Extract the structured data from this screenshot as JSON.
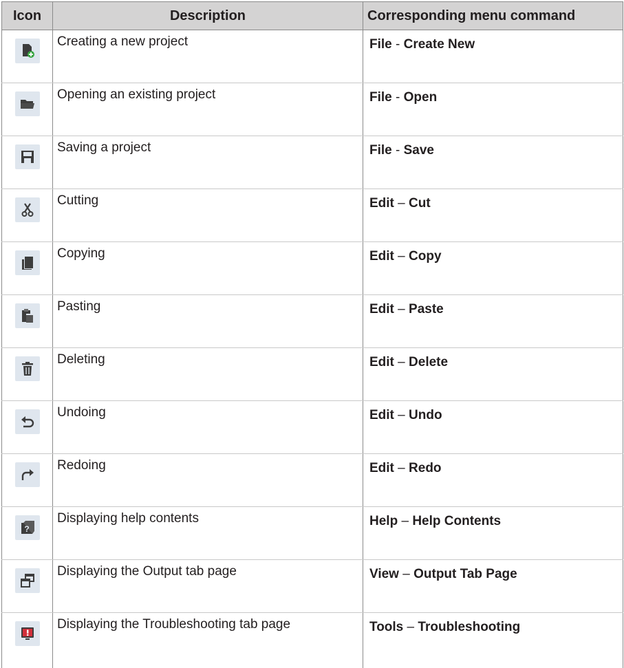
{
  "header": {
    "icon": "Icon",
    "description": "Description",
    "command": "Corresponding menu command"
  },
  "rows": [
    {
      "icon": "create-new-icon",
      "description": "Creating a new project",
      "menu": "File",
      "sep": "-",
      "command": "Create New"
    },
    {
      "icon": "open-folder-icon",
      "description": "Opening an existing project",
      "menu": "File",
      "sep": "-",
      "command": "Open"
    },
    {
      "icon": "save-icon",
      "description": "Saving a project",
      "menu": "File",
      "sep": "-",
      "command": "Save"
    },
    {
      "icon": "scissors-icon",
      "description": "Cutting",
      "menu": "Edit",
      "sep": "–",
      "command": "Cut"
    },
    {
      "icon": "copy-icon",
      "description": "Copying",
      "menu": "Edit",
      "sep": "–",
      "command": "Copy"
    },
    {
      "icon": "paste-icon",
      "description": "Pasting",
      "menu": "Edit",
      "sep": "–",
      "command": "Paste"
    },
    {
      "icon": "trash-icon",
      "description": "Deleting",
      "menu": "Edit",
      "sep": "–",
      "command": "Delete"
    },
    {
      "icon": "undo-icon",
      "description": "Undoing",
      "menu": "Edit",
      "sep": "–",
      "command": "Undo"
    },
    {
      "icon": "redo-icon",
      "description": "Redoing",
      "menu": "Edit",
      "sep": "–",
      "command": "Redo"
    },
    {
      "icon": "help-icon",
      "description": "Displaying help contents",
      "menu": "Help",
      "sep": "–",
      "command": "Help Contents"
    },
    {
      "icon": "output-window-icon",
      "description": "Displaying the Output tab page",
      "menu": "View",
      "sep": "–",
      "command": "Output Tab Page"
    },
    {
      "icon": "troubleshooting-icon",
      "description": "Displaying the Troubleshooting tab page",
      "menu": "Tools",
      "sep": "–",
      "command": "Troubleshooting"
    }
  ]
}
